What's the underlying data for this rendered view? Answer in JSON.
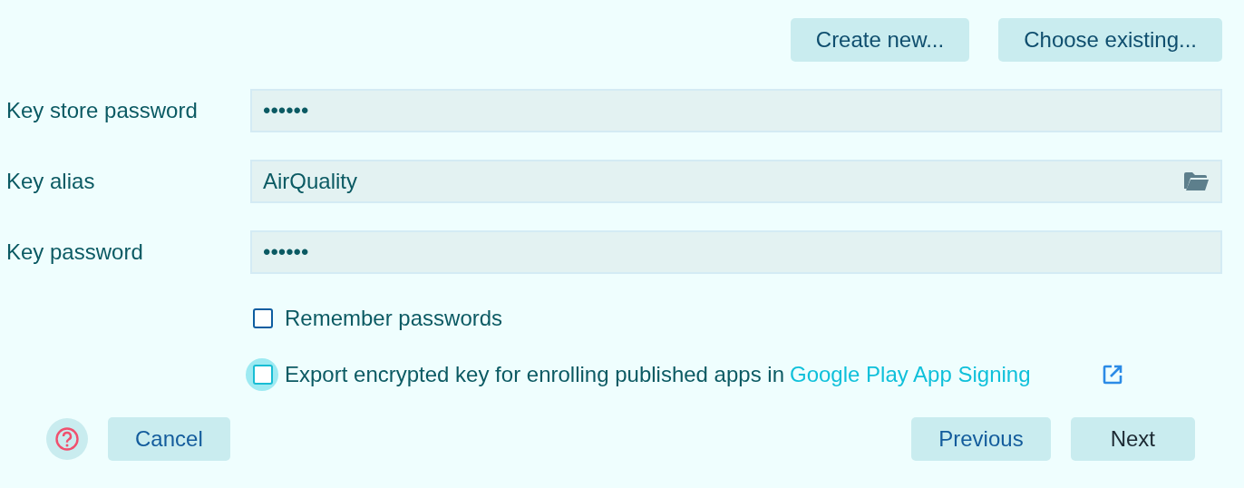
{
  "top_buttons": [
    {
      "label": "Create new..."
    },
    {
      "label": "Choose existing..."
    }
  ],
  "fields": [
    {
      "label": "Key store password",
      "value": "••••••",
      "kind": "password"
    },
    {
      "label": "Key alias",
      "value": "AirQuality",
      "kind": "browse"
    },
    {
      "label": "Key password",
      "value": "••••••",
      "kind": "password"
    }
  ],
  "checkboxes": [
    {
      "label": "Remember passwords",
      "checked": false,
      "focused": false
    },
    {
      "label": "Export encrypted key for enrolling published apps in",
      "link": "Google Play App Signing",
      "checked": false,
      "focused": true
    }
  ],
  "bottom": {
    "left": [
      {
        "label": "Cancel"
      }
    ],
    "right": [
      {
        "label": "Previous"
      },
      {
        "label": "Next",
        "default": true
      }
    ]
  }
}
